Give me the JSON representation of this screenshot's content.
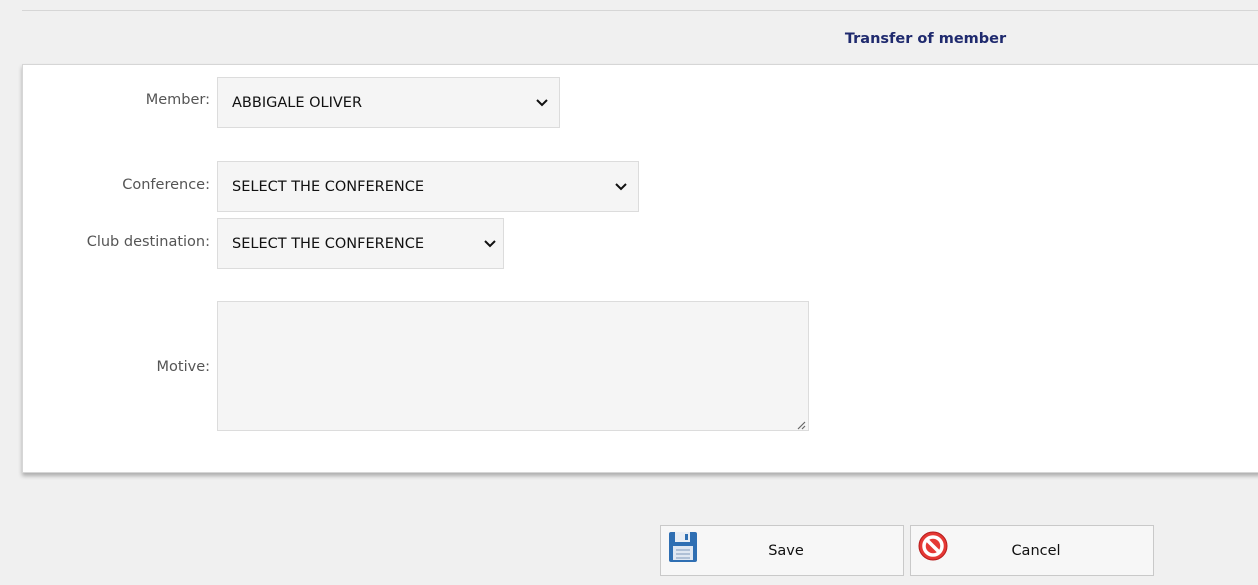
{
  "form": {
    "title": "Transfer of member",
    "member": {
      "label": "Member:",
      "value": "ABBIGALE OLIVER"
    },
    "conference": {
      "label": "Conference:",
      "value": "SELECT THE CONFERENCE"
    },
    "club_destination": {
      "label": "Club destination:",
      "value": "SELECT THE CONFERENCE"
    },
    "motive": {
      "label": "Motive:",
      "value": ""
    }
  },
  "actions": {
    "save_label": "Save",
    "cancel_label": "Cancel"
  },
  "icons": {
    "save": "floppy-disk-icon",
    "cancel": "no-entry-icon"
  },
  "colors": {
    "title": "#1f2a6e",
    "cancel_icon": "#e53935",
    "save_icon": "#2f6fb3"
  }
}
